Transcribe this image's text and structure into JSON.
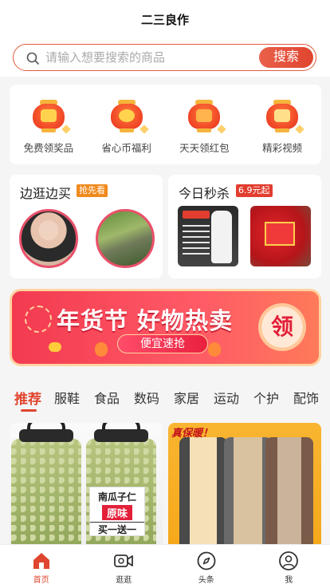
{
  "header": {
    "title": "二三良作"
  },
  "search": {
    "placeholder": "请输入想要搜索的商品",
    "button_label": "搜索"
  },
  "quick_icons": [
    {
      "label": "免费领奖品",
      "icon": "gift-lantern-icon"
    },
    {
      "label": "省心币福利",
      "icon": "coin-lantern-icon"
    },
    {
      "label": "天天领红包",
      "icon": "red-envelope-lantern-icon"
    },
    {
      "label": "精彩视频",
      "icon": "video-lantern-icon"
    }
  ],
  "promo": {
    "left": {
      "title": "边逛边买",
      "tag": "抢先看"
    },
    "right": {
      "title": "今日秒杀",
      "tag": "6.9元起"
    }
  },
  "banner": {
    "title": "年货节 好物热卖",
    "subtitle": "便宜速抢",
    "badge": "领"
  },
  "tabs": [
    "推荐",
    "服鞋",
    "食品",
    "数码",
    "家居",
    "运动",
    "个护",
    "配饰"
  ],
  "feed": {
    "item1": {
      "label_line1": "南瓜子仁",
      "label_line2": "原味",
      "label_line3": "买一送一"
    },
    "item2": {
      "overlay_text": "真保暖！"
    }
  },
  "nav": [
    {
      "label": "首页",
      "icon": "home-icon",
      "active": true
    },
    {
      "label": "逛逛",
      "icon": "video-camera-icon",
      "active": false
    },
    {
      "label": "头条",
      "icon": "compass-icon",
      "active": false
    },
    {
      "label": "我",
      "icon": "user-icon",
      "active": false
    }
  ],
  "colors": {
    "accent": "#e0452f",
    "banner": "#f33a50"
  }
}
